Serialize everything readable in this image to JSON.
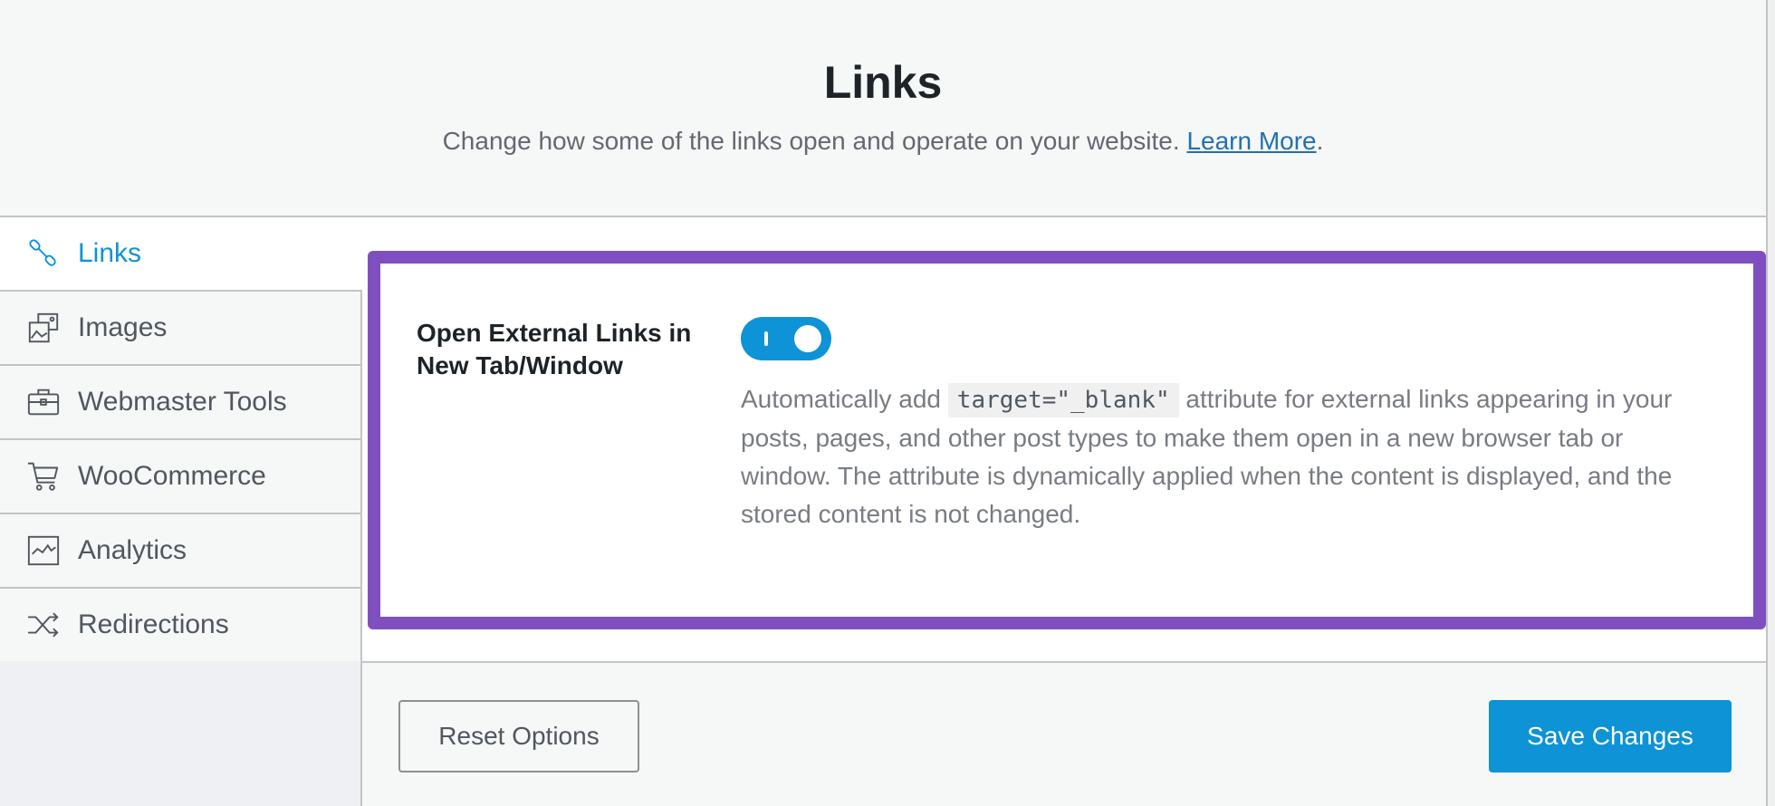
{
  "header": {
    "title": "Links",
    "description": "Change how some of the links open and operate on your website.",
    "learn_more": "Learn More",
    "period": "."
  },
  "sidebar": {
    "items": [
      {
        "label": "Links",
        "icon": "link-icon",
        "active": true
      },
      {
        "label": "Images",
        "icon": "images-icon",
        "active": false
      },
      {
        "label": "Webmaster Tools",
        "icon": "briefcase-icon",
        "active": false
      },
      {
        "label": "WooCommerce",
        "icon": "cart-icon",
        "active": false
      },
      {
        "label": "Analytics",
        "icon": "analytics-chart-icon",
        "active": false
      },
      {
        "label": "Redirections",
        "icon": "shuffle-icon",
        "active": false
      }
    ]
  },
  "setting": {
    "label": "Open External Links in New Tab/Window",
    "toggle_on": true,
    "desc_before": "Automatically add",
    "desc_code": "target=\"_blank\"",
    "desc_after": "attribute for external links appearing in your posts, pages, and other post types to make them open in a new browser tab or window. The attribute is dynamically applied when the content is displayed, and the stored content is not changed."
  },
  "footer": {
    "reset_label": "Reset Options",
    "save_label": "Save Changes"
  },
  "colors": {
    "accent": "#0d93d6",
    "highlight": "#7f4fc0",
    "link": "#2271b1"
  }
}
